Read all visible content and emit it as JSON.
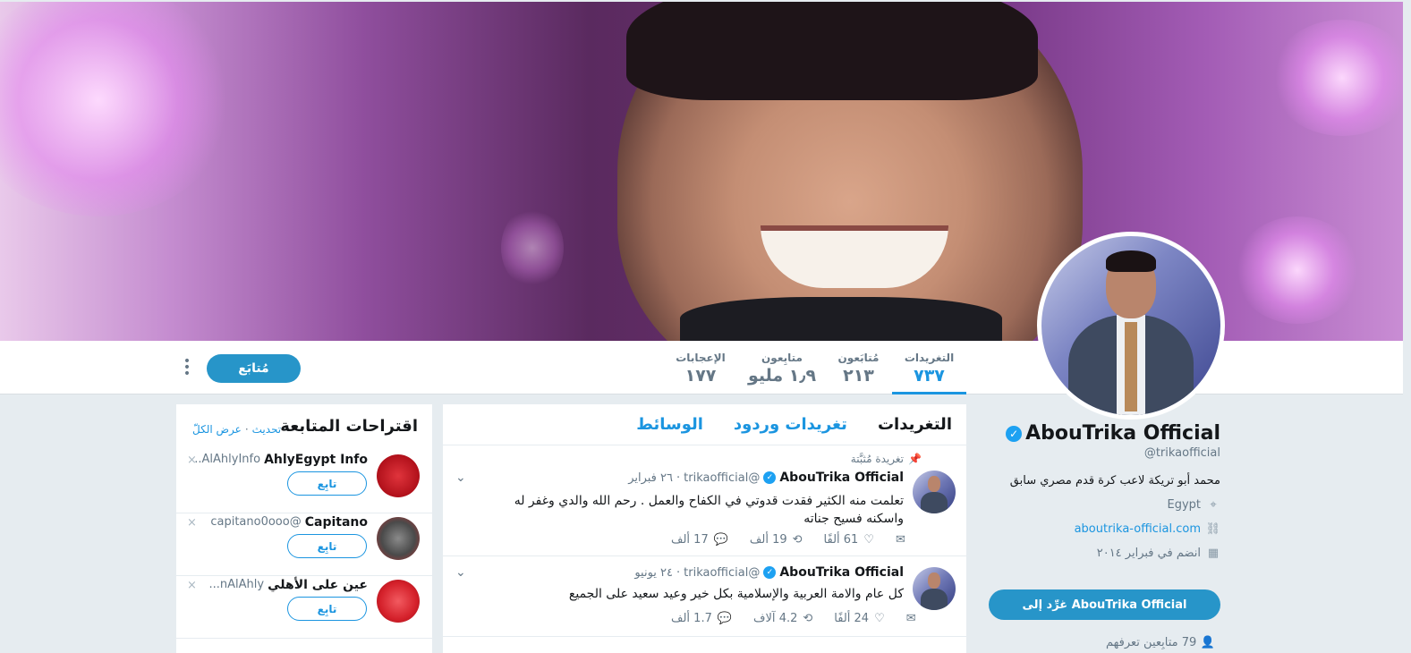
{
  "navbar": {
    "stats": [
      {
        "label": "التغريدات",
        "value": "٧٣٧"
      },
      {
        "label": "مُتابَعون",
        "value": "٢١٣"
      },
      {
        "label": "متابِعون",
        "value": "١٫٩ مليو"
      },
      {
        "label": "الإعجابات",
        "value": "١٧٧"
      }
    ],
    "follow_label": "مُتابَع",
    "more_icon": "⋮"
  },
  "profile": {
    "name": "AbouTrika Official",
    "handle": "@trikaofficial",
    "bio": "محمد أبو تريكة لاعب كرة قدم مصري سابق",
    "location": "Egypt",
    "website": "aboutrika-official.com",
    "joined": "انضم في فبراير ٢٠١٤",
    "tweet_to_label": "غرِّد إلى AbouTrika Official",
    "mutual": "79 متابِعين تعرفهم"
  },
  "timeline": {
    "tabs": [
      "التغريدات",
      "تغريدات وردود",
      "الوسائط"
    ],
    "tweets": [
      {
        "pinned": "تغريدة مُثبَّتة",
        "name": "AbouTrika Official",
        "handle": "@trikaofficial",
        "date": "٢٦ فبراير",
        "text": "تعلمت منه الكثير فقدت قدوتي في الكفاح والعمل . رحم الله والدي وغفر له واسكنه فسيح جناته",
        "replies": "17 ألف",
        "retweets": "19 ألف",
        "likes": "61 ألفًا"
      },
      {
        "name": "AbouTrika Official",
        "handle": "@trikaofficial",
        "date": "٢٤ يونيو",
        "text": "كل عام والامة العربية والإسلامية بكل خير وعيد سعيد على الجميع",
        "replies": "1.7 ألف",
        "retweets": "4.2 آلاف",
        "likes": "24 ألفًا"
      }
    ]
  },
  "who_to_follow": {
    "title": "اقتراحات المتابعة",
    "refresh": "تحديث",
    "view_all": "عرض الكلّ",
    "follow_label": "تابِع",
    "suggestions": [
      {
        "name": "AhlyEgypt Info",
        "handle": "AlAhlyInfo..",
        "avatar_color": "#c0141c"
      },
      {
        "name": "Capitano",
        "handle": "@capitano0ooo",
        "avatar_color": "#3a3a3a"
      },
      {
        "name": "عين على الأهلي",
        "handle": "nAlAhly...",
        "avatar_color": "#d4202a"
      }
    ]
  },
  "colors": {
    "accent": "#1b95e0",
    "button": "#2795c9"
  }
}
